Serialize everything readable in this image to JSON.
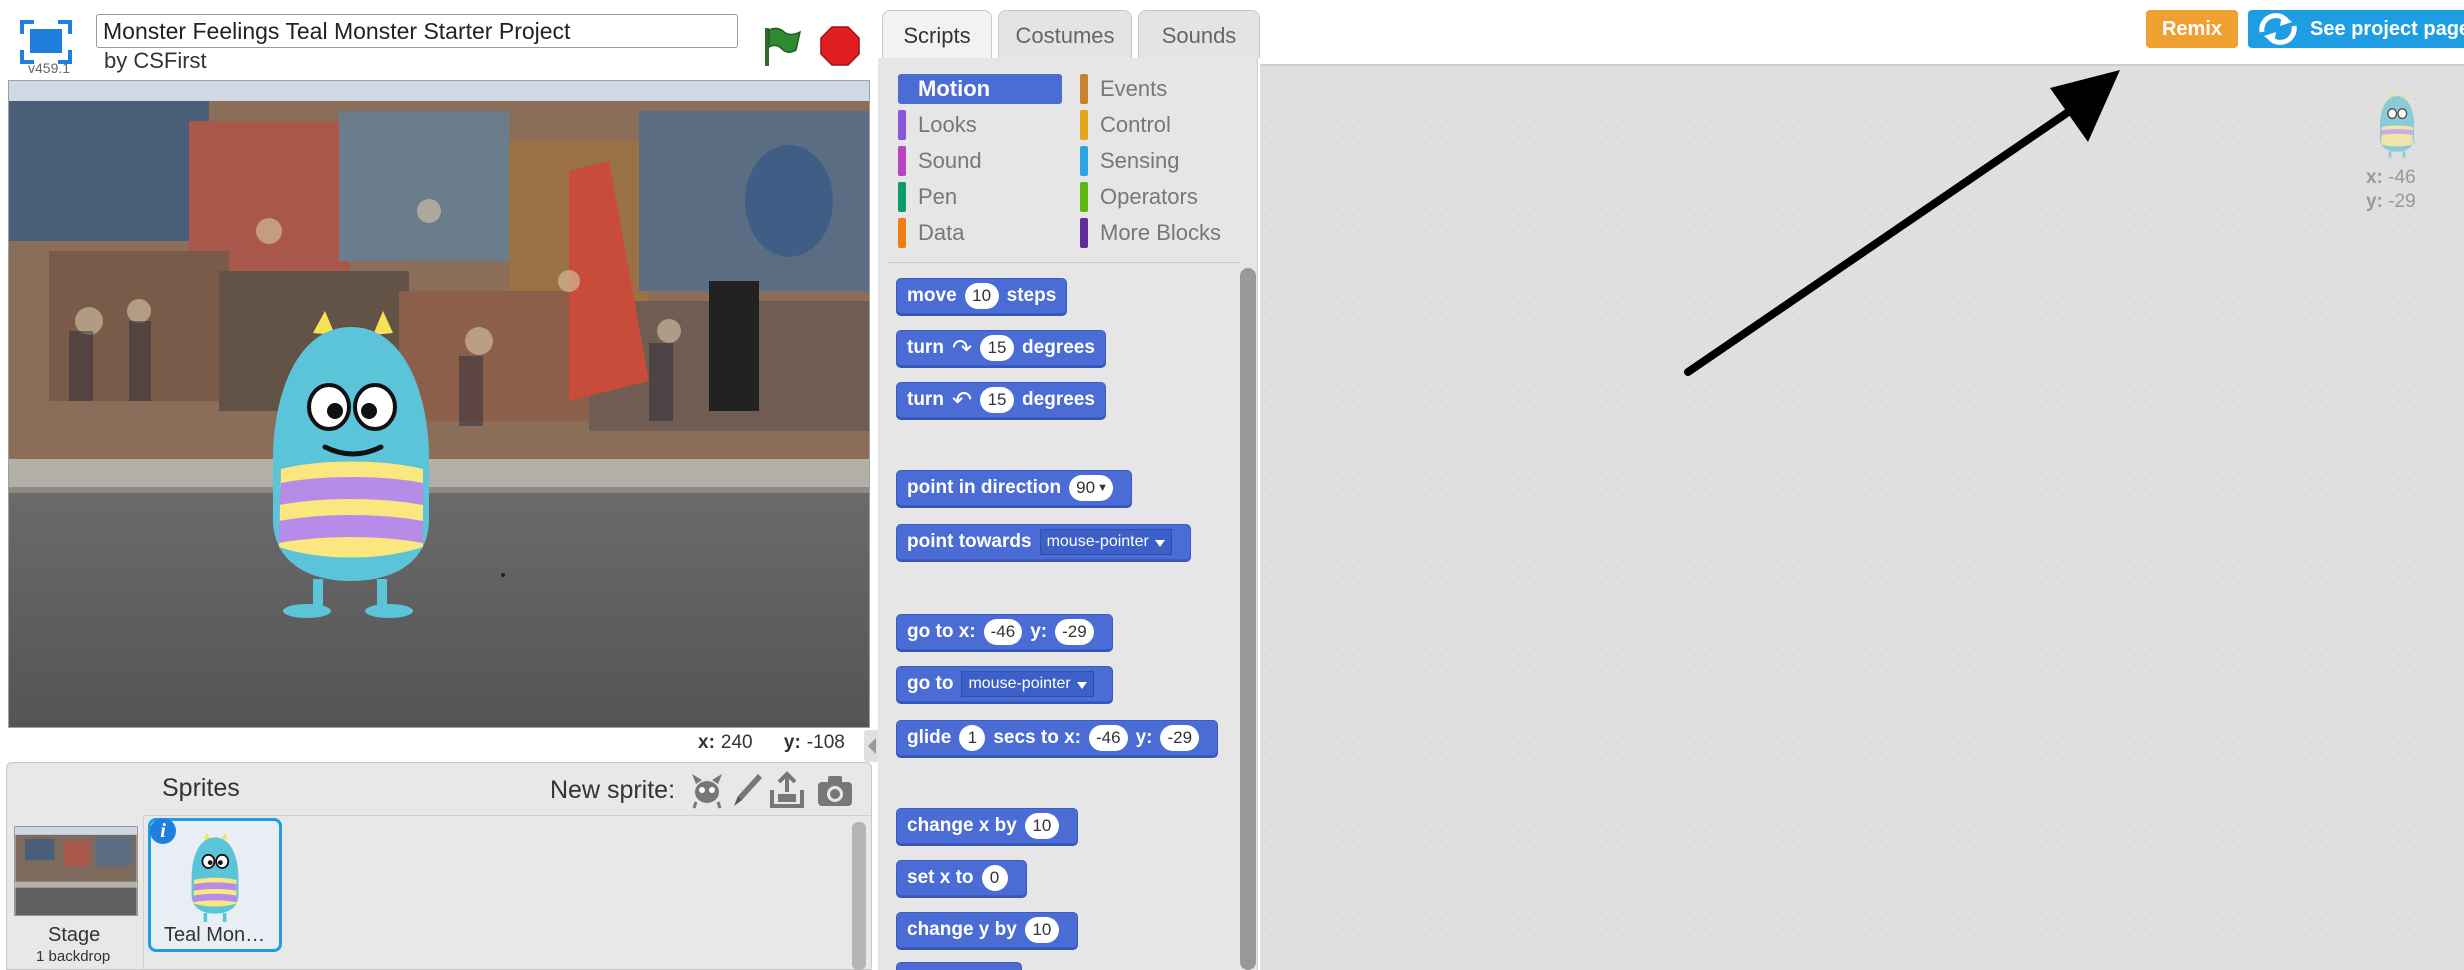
{
  "app": {
    "version": "v459.1",
    "project_title": "Monster Feelings Teal Monster Starter Project",
    "author": "by CSFirst"
  },
  "stage": {
    "mouse_x_label": "x:",
    "mouse_x": "240",
    "mouse_y_label": "y:",
    "mouse_y": "-108"
  },
  "sprites_pane": {
    "title": "Sprites",
    "new_sprite_label": "New sprite:",
    "stage_name": "Stage",
    "stage_backdrops": "1 backdrop",
    "sprites": [
      {
        "name": "Teal Mon…"
      }
    ]
  },
  "tabs": [
    "Scripts",
    "Costumes",
    "Sounds"
  ],
  "categories": [
    {
      "label": "Motion",
      "color": "#4a6cd4",
      "active": true
    },
    {
      "label": "Looks",
      "color": "#8a55d7"
    },
    {
      "label": "Sound",
      "color": "#bb42c3"
    },
    {
      "label": "Pen",
      "color": "#0e9a6c"
    },
    {
      "label": "Data",
      "color": "#ee7d16"
    },
    {
      "label": "Events",
      "color": "#c88330"
    },
    {
      "label": "Control",
      "color": "#e1a91a"
    },
    {
      "label": "Sensing",
      "color": "#2ca5e2"
    },
    {
      "label": "Operators",
      "color": "#5cb712"
    },
    {
      "label": "More Blocks",
      "color": "#632d99"
    }
  ],
  "blocks": {
    "move": {
      "w1": "move",
      "v": "10",
      "w2": "steps"
    },
    "turn_right": {
      "w1": "turn",
      "v": "15",
      "w2": "degrees"
    },
    "turn_left": {
      "w1": "turn",
      "v": "15",
      "w2": "degrees"
    },
    "point_direction": {
      "w1": "point in direction",
      "v": "90"
    },
    "point_towards": {
      "w1": "point towards",
      "v": "mouse-pointer"
    },
    "go_to_xy": {
      "w1": "go to x:",
      "x": "-46",
      "w2": "y:",
      "y": "-29"
    },
    "go_to": {
      "w1": "go to",
      "v": "mouse-pointer"
    },
    "glide": {
      "w1": "glide",
      "secs": "1",
      "w2": "secs to x:",
      "x": "-46",
      "w3": "y:",
      "y": "-29"
    },
    "change_x": {
      "w1": "change x by",
      "v": "10"
    },
    "set_x": {
      "w1": "set x to",
      "v": "0"
    },
    "change_y": {
      "w1": "change y by",
      "v": "10"
    }
  },
  "header_buttons": {
    "remix": "Remix",
    "see_project_page": "See project page"
  },
  "script_area": {
    "sprite_x_label": "x:",
    "sprite_x": "-46",
    "sprite_y_label": "y:",
    "sprite_y": "-29"
  },
  "colors": {
    "motion": "#4a6cd4",
    "remix": "#f0a030",
    "see_project": "#1f9de2",
    "monster_teal": "#5bc4d8",
    "stripe_yellow": "#fbe77f",
    "stripe_purple": "#b68ce8"
  }
}
